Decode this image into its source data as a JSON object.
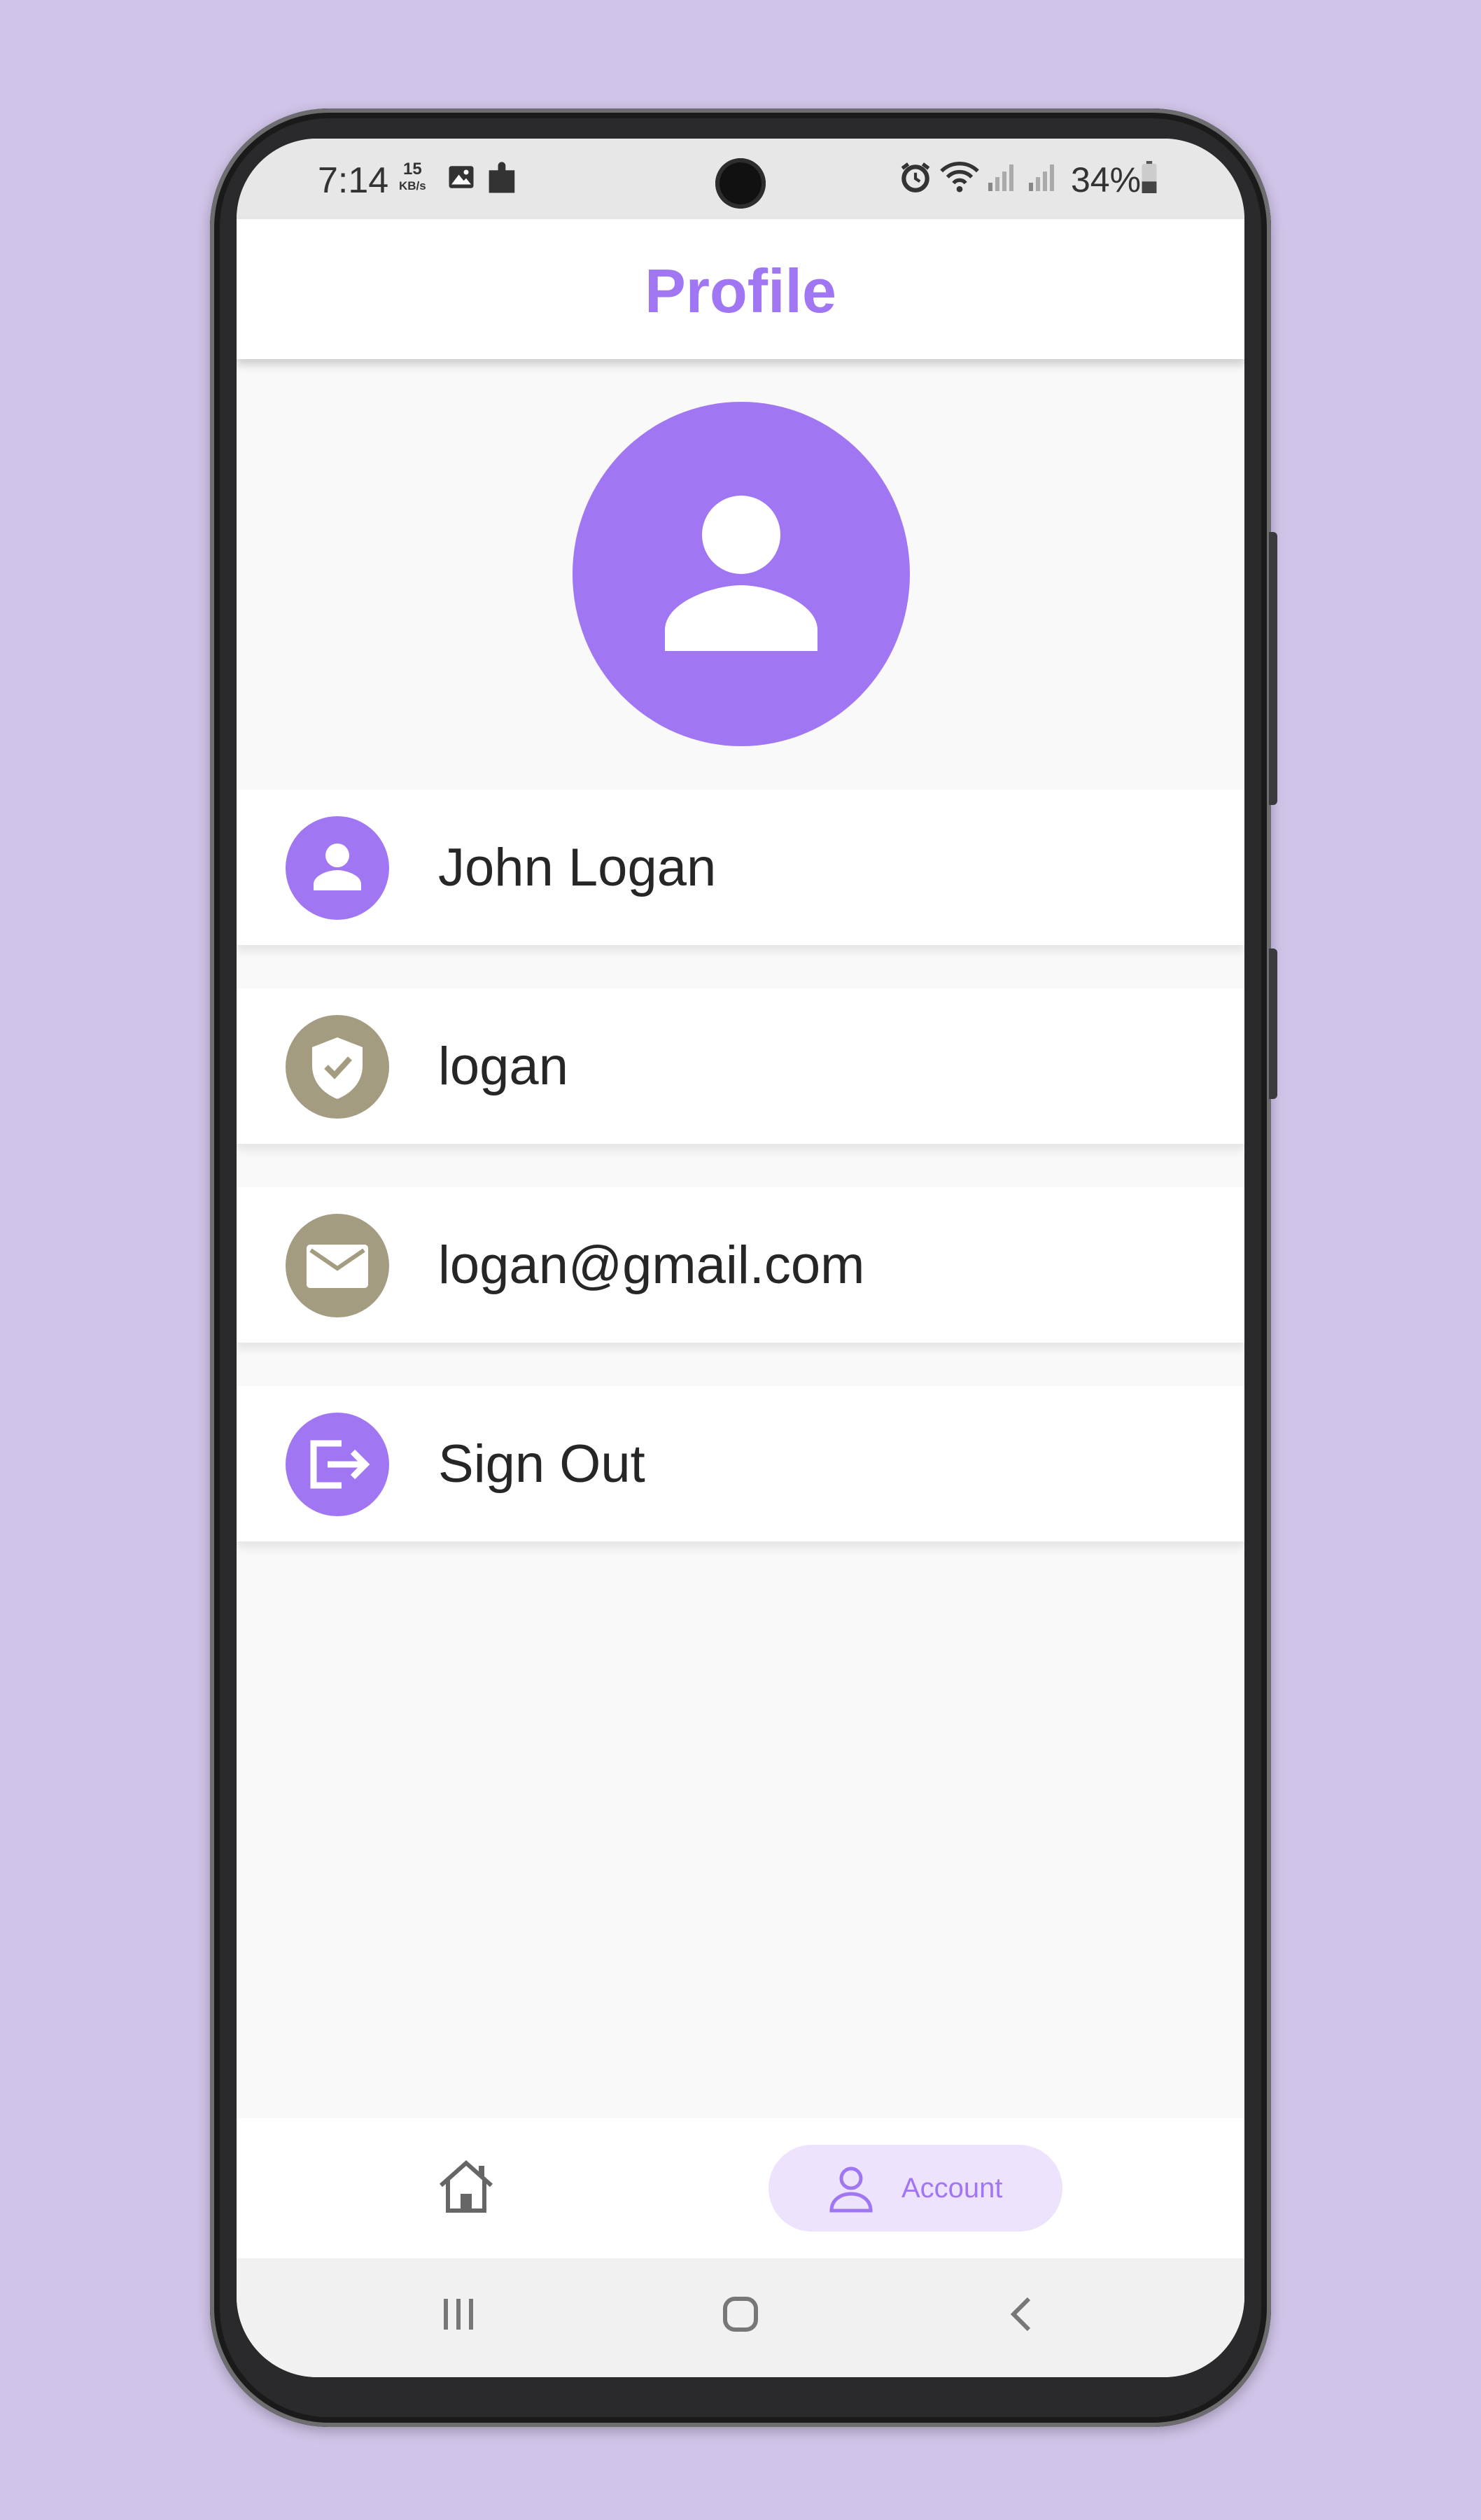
{
  "status_bar": {
    "time": "7:14",
    "speed_value": "15",
    "speed_unit": "KB/s",
    "battery": "34%",
    "icons": [
      "image-icon",
      "puzzle-icon",
      "alarm-icon",
      "wifi-icon",
      "signal-icon",
      "signal-icon",
      "battery-icon"
    ]
  },
  "header": {
    "title": "Profile"
  },
  "avatar": {
    "icon": "person-icon",
    "color": "#a176f3"
  },
  "profile_rows": [
    {
      "icon": "person-icon",
      "label": "John Logan",
      "icon_bg": "#a176f3"
    },
    {
      "icon": "shield-check-icon",
      "label": "logan",
      "icon_bg": "#a39c80"
    },
    {
      "icon": "mail-icon",
      "label": "logan@gmail.com",
      "icon_bg": "#a39c80"
    },
    {
      "icon": "sign-out-icon",
      "label": "Sign Out",
      "icon_bg": "#a176f3"
    }
  ],
  "bottom_nav": {
    "items": [
      {
        "icon": "home-icon",
        "label": ""
      },
      {
        "icon": "account-icon",
        "label": "Account",
        "active": true
      }
    ]
  },
  "system_nav": {
    "icons": [
      "recents-icon",
      "home-button-icon",
      "back-icon"
    ]
  },
  "colors": {
    "accent": "#a176f3",
    "secondary": "#a39c80",
    "background": "#d0c4e8"
  }
}
